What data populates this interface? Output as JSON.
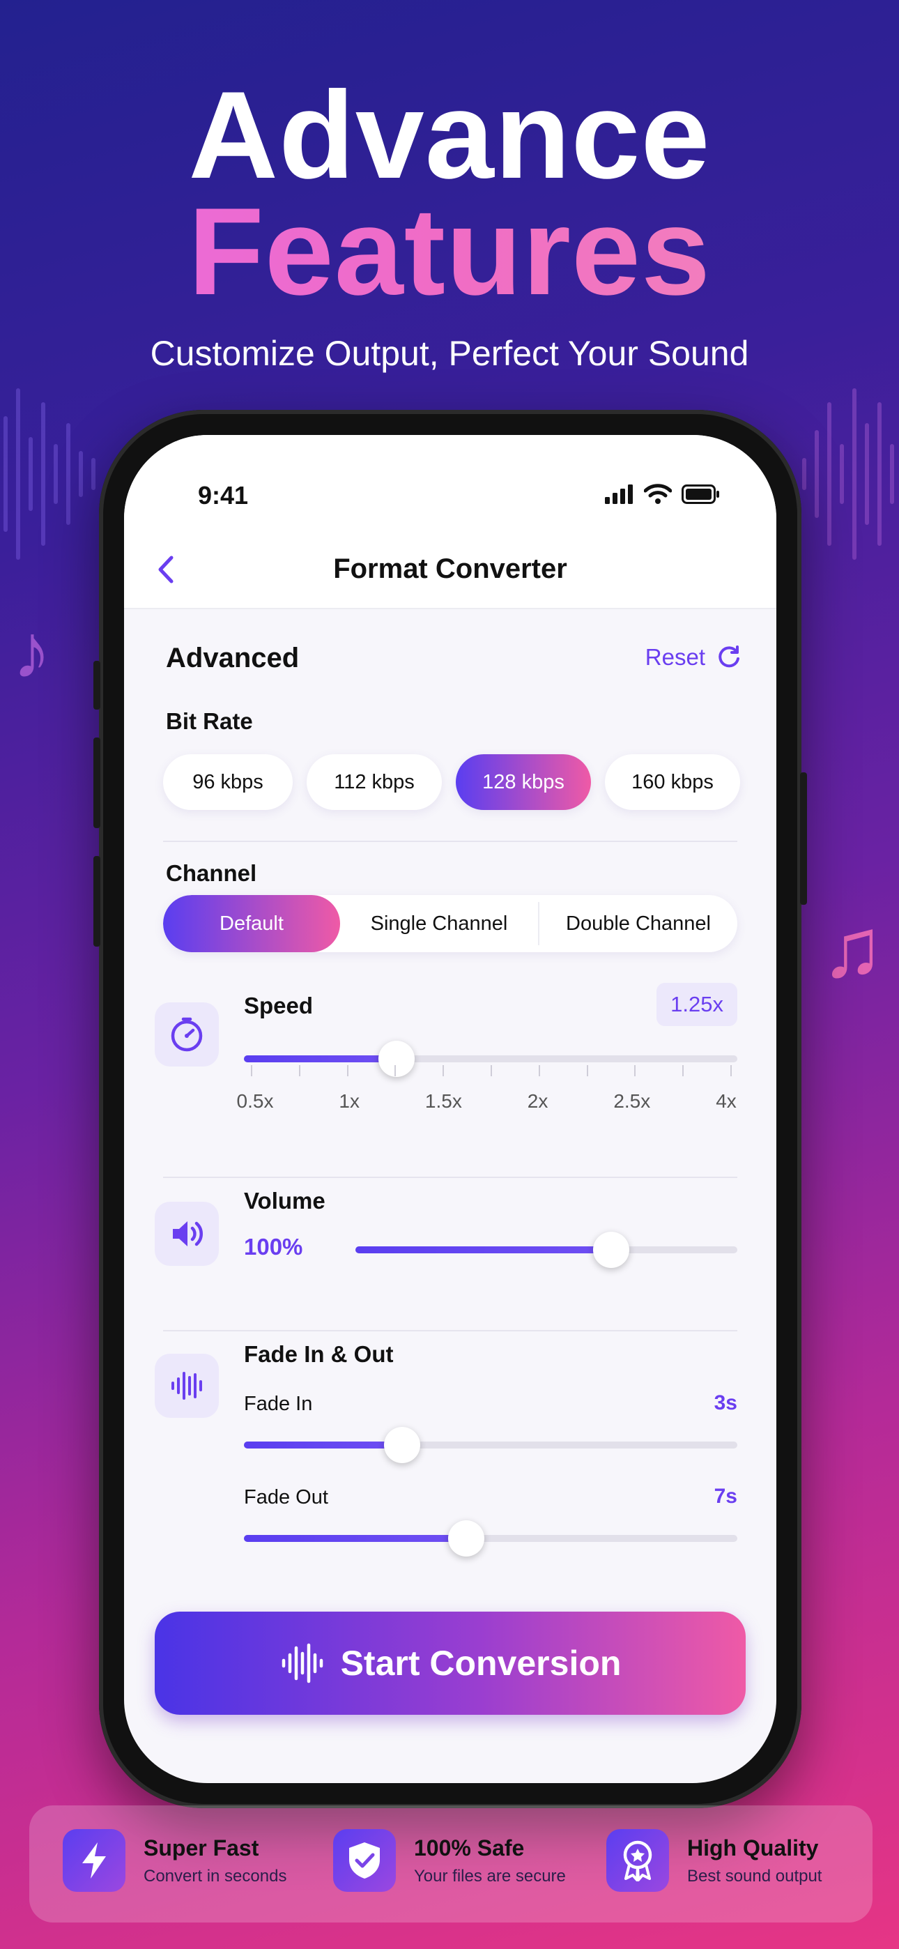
{
  "hero": {
    "title_line1": "Advance",
    "title_line2": "Features",
    "subtitle": "Customize Output, Perfect Your Sound"
  },
  "decor": {
    "note_left": "♪",
    "note_right": "♫"
  },
  "status_bar": {
    "time": "9:41"
  },
  "nav": {
    "title": "Format Converter"
  },
  "advanced": {
    "heading": "Advanced",
    "reset_label": "Reset"
  },
  "bit_rate": {
    "label": "Bit Rate",
    "options": [
      "96 kbps",
      "112 kbps",
      "128 kbps",
      "160 kbps"
    ],
    "selected": "128 kbps"
  },
  "channel": {
    "label": "Channel",
    "options": [
      "Default",
      "Single Channel",
      "Double Channel"
    ],
    "selected": "Default"
  },
  "speed": {
    "label": "Speed",
    "value_badge": "1.25x",
    "ticks": [
      "0.5x",
      "1x",
      "1.5x",
      "2x",
      "2.5x",
      "4x"
    ],
    "fill_fraction": 0.31
  },
  "volume": {
    "label": "Volume",
    "value": "100%",
    "fill_fraction": 0.67
  },
  "fade": {
    "label": "Fade In & Out",
    "fade_in_label": "Fade In",
    "fade_in_value": "3s",
    "fade_in_fraction": 0.32,
    "fade_out_label": "Fade Out",
    "fade_out_value": "7s",
    "fade_out_fraction": 0.45
  },
  "cta": {
    "label": "Start Conversion"
  },
  "features": [
    {
      "title": "Super Fast",
      "subtitle": "Convert in seconds",
      "icon": "lightning-icon"
    },
    {
      "title": "100% Safe",
      "subtitle": "Your files are secure",
      "icon": "shield-check-icon"
    },
    {
      "title": "High Quality",
      "subtitle": "Best sound output",
      "icon": "award-badge-icon"
    }
  ],
  "colors": {
    "accent": "#6a3ef0",
    "gradient_start": "#5a3ef0",
    "gradient_end": "#ef5aa6"
  }
}
